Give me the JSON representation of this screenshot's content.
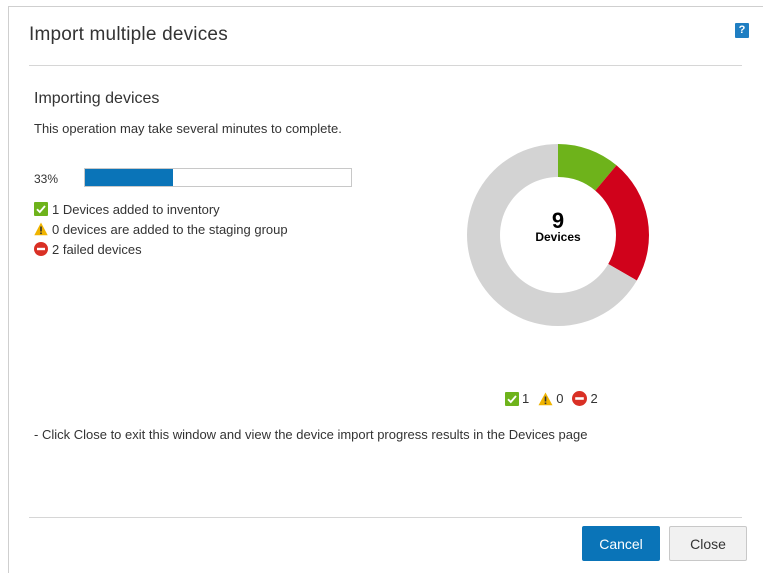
{
  "dialog": {
    "title": "Import multiple devices",
    "help_label": "?"
  },
  "section": {
    "heading": "Importing devices",
    "description": "This operation may take several minutes to complete."
  },
  "progress": {
    "percent_label": "33%",
    "percent_value": 33
  },
  "status": {
    "added": "1 Devices added to inventory",
    "staging": "0 devices are added to the staging group",
    "failed": "2 failed devices"
  },
  "colors": {
    "success": "#6eb31b",
    "warning": "#f0b400",
    "failed": "#d0021b",
    "pending": "#d3d3d3",
    "primary": "#0a74b8"
  },
  "chart_data": {
    "type": "pie",
    "total": 9,
    "center_count": "9",
    "center_label": "Devices",
    "categories": [
      "success",
      "warning",
      "failed",
      "pending"
    ],
    "values": [
      1,
      0,
      2,
      6
    ]
  },
  "legend": {
    "success_count": "1",
    "warning_count": "0",
    "failed_count": "2"
  },
  "footer": {
    "note": "- Click Close to exit this window and view the device import progress results in the Devices page",
    "cancel_label": "Cancel",
    "close_label": "Close"
  }
}
